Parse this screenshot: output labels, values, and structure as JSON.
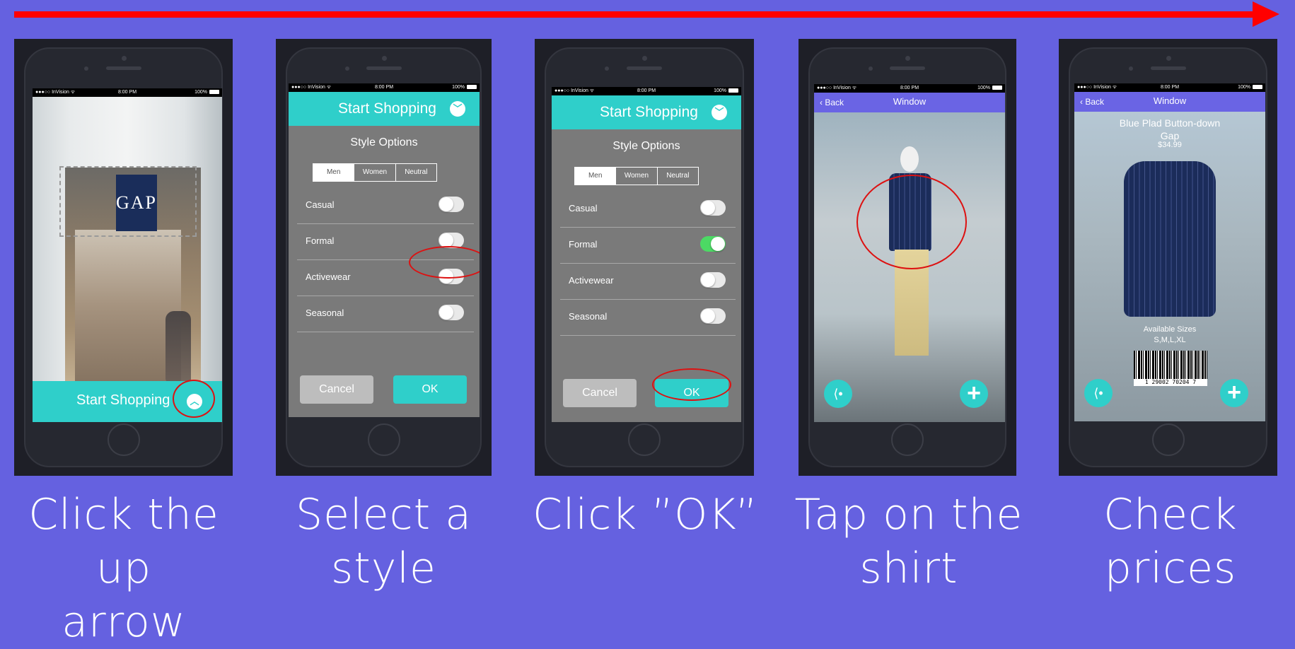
{
  "colors": {
    "background": "#6561e0",
    "accent": "#2fcfca",
    "arrow": "#ff0000",
    "nav": "#6a64e4",
    "toggle_on": "#4cd964"
  },
  "status": {
    "carrier": "●●●○○ InVision ᯤ",
    "time": "8:00 PM",
    "battery": "100%"
  },
  "steps": [
    {
      "caption": [
        "Click the up",
        "arrow"
      ]
    },
    {
      "caption": [
        "Select a",
        "style"
      ]
    },
    {
      "caption": [
        "Click ”OK”"
      ]
    },
    {
      "caption": [
        "Tap on the",
        "shirt"
      ]
    },
    {
      "caption": [
        "Check",
        "prices"
      ]
    }
  ],
  "store": {
    "sign": "GAP",
    "bar_label": "Start Shopping",
    "up_icon": "chevron-up-icon"
  },
  "style_screen": {
    "header": "Start Shopping",
    "down_icon": "chevron-down-icon",
    "title": "Style Options",
    "segments": [
      "Men",
      "Women",
      "Neutral"
    ],
    "selected_segment": "Men",
    "options": [
      {
        "label": "Casual"
      },
      {
        "label": "Formal"
      },
      {
        "label": "Activewear"
      },
      {
        "label": "Seasonal"
      }
    ],
    "screen2_toggles": [
      false,
      false,
      false,
      false
    ],
    "screen3_toggles": [
      false,
      true,
      false,
      false
    ],
    "cancel": "Cancel",
    "ok": "OK"
  },
  "window_screen": {
    "back": "Back",
    "title": "Window"
  },
  "product": {
    "name": "Blue Plad Button-down",
    "brand": "Gap",
    "price": "$34.99",
    "sizes_label": "Available Sizes",
    "sizes": "S,M,L,XL",
    "barcode": "1 29002 70204 7"
  }
}
